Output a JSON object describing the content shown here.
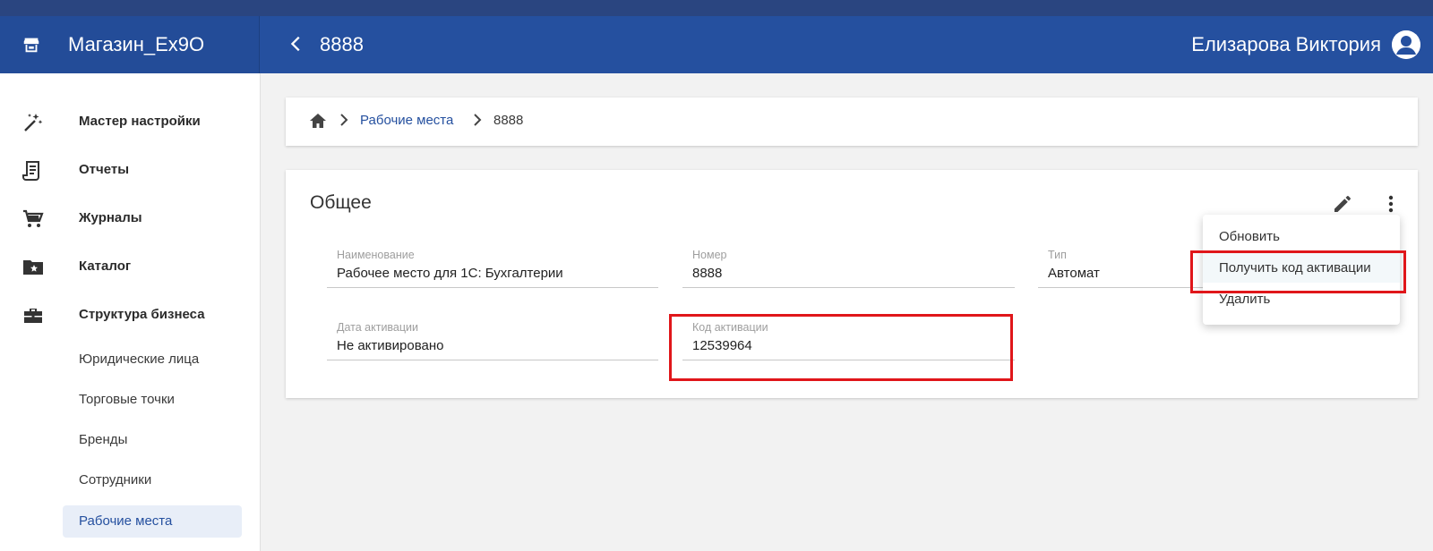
{
  "app": {
    "name": "Магазин_Ex9O",
    "page_heading": "8888",
    "user_name": "Елизарова Виктория"
  },
  "sidebar": {
    "items": [
      {
        "label": "Мастер настройки",
        "icon": "magic-wand-icon"
      },
      {
        "label": "Отчеты",
        "icon": "receipt-icon"
      },
      {
        "label": "Журналы",
        "icon": "cart-icon"
      },
      {
        "label": "Каталог",
        "icon": "folder-star-icon"
      },
      {
        "label": "Структура бизнеса",
        "icon": "briefcase-icon"
      }
    ],
    "subitems": [
      {
        "label": "Юридические лица"
      },
      {
        "label": "Торговые точки"
      },
      {
        "label": "Бренды"
      },
      {
        "label": "Сотрудники"
      },
      {
        "label": "Рабочие места",
        "active": true
      }
    ]
  },
  "breadcrumb": {
    "link": "Рабочие места",
    "current": "8888"
  },
  "section": {
    "title": "Общее",
    "fields": [
      {
        "label": "Наименование",
        "value": "Рабочее место для 1С: Бухгалтерии"
      },
      {
        "label": "Номер",
        "value": "8888"
      },
      {
        "label": "Тип",
        "value": "Автомат"
      },
      {
        "label": "Дата активации",
        "value": "Не активировано"
      },
      {
        "label": "Код активации",
        "value": "12539964"
      }
    ]
  },
  "menu": {
    "items": [
      {
        "label": "Обновить"
      },
      {
        "label": "Получить код активации"
      },
      {
        "label": "Удалить"
      }
    ]
  },
  "colors": {
    "appbar": "#25509f",
    "accent_link": "#25509f",
    "highlight_red": "#e0161a"
  }
}
